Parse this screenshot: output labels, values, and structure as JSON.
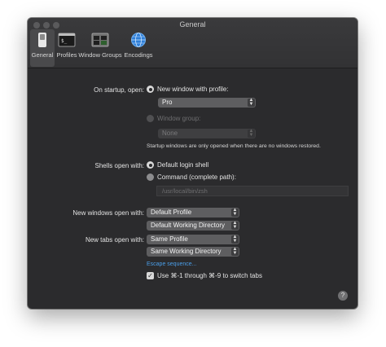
{
  "window": {
    "title": "General"
  },
  "toolbar": {
    "items": [
      {
        "label": "General",
        "icon": "switch-icon",
        "selected": true
      },
      {
        "label": "Profiles",
        "icon": "terminal-icon"
      },
      {
        "label": "Window Groups",
        "icon": "window-groups-icon"
      },
      {
        "label": "Encodings",
        "icon": "globe-icon"
      }
    ]
  },
  "startup": {
    "label": "On startup, open:",
    "new_window_option": "New window with profile:",
    "profile_value": "Pro",
    "window_group_option": "Window group:",
    "window_group_value": "None",
    "note": "Startup windows are only opened when there are no windows restored."
  },
  "shells": {
    "label": "Shells open with:",
    "default_option": "Default login shell",
    "command_option": "Command (complete path):",
    "command_value": "/usr/local/bin/zsh"
  },
  "new_windows": {
    "label": "New windows open with:",
    "profile_value": "Default Profile",
    "directory_value": "Default Working Directory"
  },
  "new_tabs": {
    "label": "New tabs open with:",
    "profile_value": "Same Profile",
    "directory_value": "Same Working Directory",
    "escape_link": "Escape sequence...",
    "switch_tabs_checkbox": "Use ⌘-1 through ⌘-9 to switch tabs"
  },
  "help": {
    "label": "?"
  },
  "colors": {
    "window_bg": "#2b2b2d",
    "accent_link": "#4a9ee8",
    "popup_bg": "#5e5e60"
  }
}
